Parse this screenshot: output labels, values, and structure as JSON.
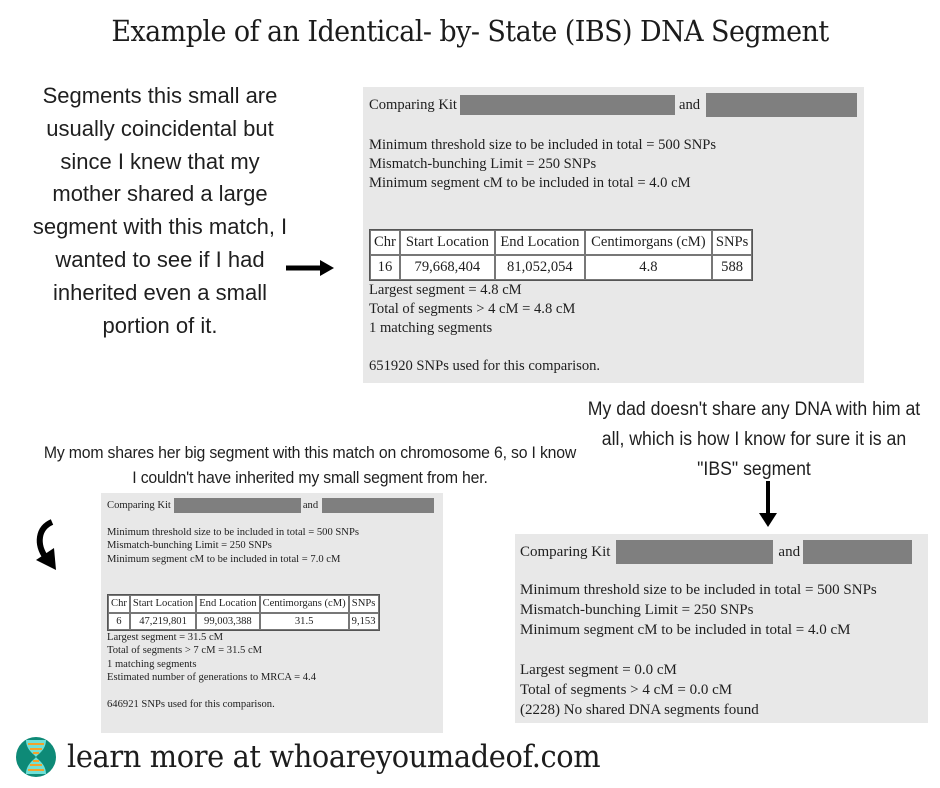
{
  "title": "Example of an Identical- by- State (IBS) DNA Segment",
  "notes": {
    "left": "Segments this small are usually coincidental but since I knew that my mother shared a large segment with this match, I wanted to see if I had inherited even a small portion of it.",
    "mom": "My mom shares her big segment with this match on chromosome 6, so I know I couldn't have inherited my small segment from her.",
    "dad": "My dad doesn't share any DNA with him at all, which is how I know for sure it is an \"IBS\" segment"
  },
  "icons": {
    "right_arrow": "right-arrow-icon",
    "curved_arrow": "curved-down-arrow-icon",
    "down_arrow": "down-arrow-icon",
    "logo": "dna-hourglass-logo-icon"
  },
  "colors": {
    "panel_bg": "#e8e8e8",
    "redaction": "#7f7f7f",
    "logo_teal": "#0e8a77",
    "logo_cyan": "#6fe0d6",
    "logo_orange": "#f2a22a"
  },
  "panels": {
    "self": {
      "comparing_label": "Comparing Kit",
      "and_label": "and",
      "min_threshold": "Minimum threshold size to be included in total = 500 SNPs",
      "mismatch_limit": "Mismatch-bunching Limit = 250 SNPs",
      "min_segment_cm": "Minimum segment cM to be included in total = 4.0 cM",
      "table": {
        "headers": [
          "Chr",
          "Start Location",
          "End Location",
          "Centimorgans (cM)",
          "SNPs"
        ],
        "rows": [
          [
            "16",
            "79,668,404",
            "81,052,054",
            "4.8",
            "588"
          ]
        ]
      },
      "largest_segment": "Largest segment = 4.8 cM",
      "total_segments": "Total of segments > 4 cM = 4.8 cM",
      "matching_segments": "1 matching segments",
      "snps_used": "651920 SNPs used for this comparison."
    },
    "mom": {
      "comparing_label": "Comparing Kit",
      "and_label": "and",
      "min_threshold": "Minimum threshold size to be included in total = 500 SNPs",
      "mismatch_limit": "Mismatch-bunching Limit = 250 SNPs",
      "min_segment_cm": "Minimum segment cM to be included in total = 7.0 cM",
      "table": {
        "headers": [
          "Chr",
          "Start Location",
          "End Location",
          "Centimorgans (cM)",
          "SNPs"
        ],
        "rows": [
          [
            "6",
            "47,219,801",
            "99,003,388",
            "31.5",
            "9,153"
          ]
        ]
      },
      "largest_segment": "Largest segment = 31.5 cM",
      "total_segments": "Total of segments > 7 cM = 31.5 cM",
      "matching_segments": "1 matching segments",
      "mrca": "Estimated number of generations to MRCA = 4.4",
      "snps_used": "646921 SNPs used for this comparison."
    },
    "dad": {
      "comparing_label": "Comparing Kit",
      "and_label": "and",
      "min_threshold": "Minimum threshold size to be included in total = 500 SNPs",
      "mismatch_limit": "Mismatch-bunching Limit = 250 SNPs",
      "min_segment_cm": "Minimum segment cM to be included in total = 4.0 cM",
      "largest_segment": "Largest segment = 0.0 cM",
      "total_segments": "Total of segments > 4 cM = 0.0 cM",
      "no_shared": "(2228) No shared DNA segments found"
    }
  },
  "footer": {
    "text": "learn more at whoareyoumadeof.com"
  }
}
